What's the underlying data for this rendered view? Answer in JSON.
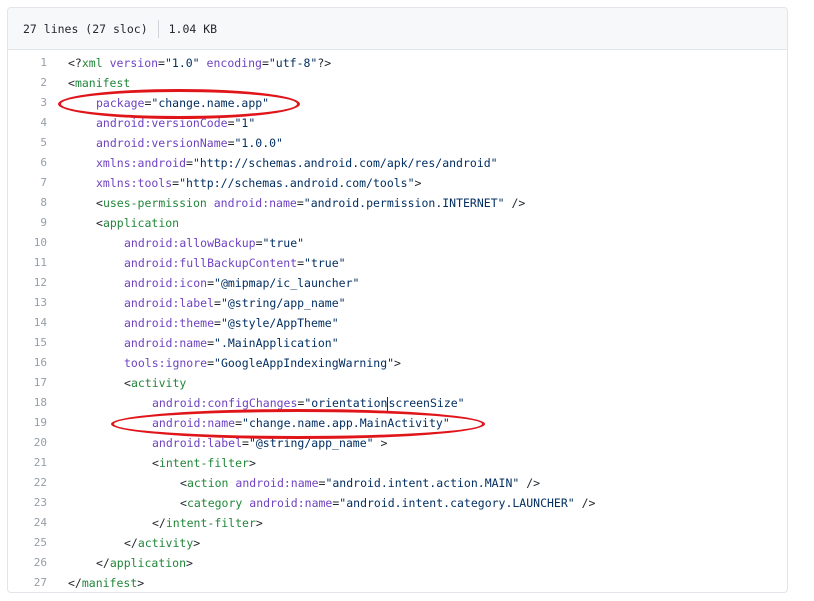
{
  "header": {
    "lines_info": "27 lines (27 sloc)",
    "size": "1.04 KB"
  },
  "code": {
    "lines": [
      {
        "n": "1",
        "indent": 0,
        "tokens": [
          {
            "t": "plain",
            "v": "<?"
          },
          {
            "t": "tag",
            "v": "xml"
          },
          {
            "t": "plain",
            "v": " "
          },
          {
            "t": "attr",
            "v": "version"
          },
          {
            "t": "plain",
            "v": "="
          },
          {
            "t": "str",
            "v": "\"1.0\""
          },
          {
            "t": "plain",
            "v": " "
          },
          {
            "t": "attr",
            "v": "encoding"
          },
          {
            "t": "plain",
            "v": "="
          },
          {
            "t": "str",
            "v": "\"utf-8\""
          },
          {
            "t": "plain",
            "v": "?>"
          }
        ]
      },
      {
        "n": "2",
        "indent": 0,
        "tokens": [
          {
            "t": "plain",
            "v": "<"
          },
          {
            "t": "tag",
            "v": "manifest"
          }
        ]
      },
      {
        "n": "3",
        "indent": 1,
        "tokens": [
          {
            "t": "attr",
            "v": "package"
          },
          {
            "t": "plain",
            "v": "="
          },
          {
            "t": "str",
            "v": "\"change.name.app\""
          }
        ]
      },
      {
        "n": "4",
        "indent": 1,
        "tokens": [
          {
            "t": "attr",
            "v": "android:versionCode"
          },
          {
            "t": "plain",
            "v": "="
          },
          {
            "t": "str",
            "v": "\"1\""
          }
        ]
      },
      {
        "n": "5",
        "indent": 1,
        "tokens": [
          {
            "t": "attr",
            "v": "android:versionName"
          },
          {
            "t": "plain",
            "v": "="
          },
          {
            "t": "str",
            "v": "\"1.0.0\""
          }
        ]
      },
      {
        "n": "6",
        "indent": 1,
        "tokens": [
          {
            "t": "attr",
            "v": "xmlns:android"
          },
          {
            "t": "plain",
            "v": "="
          },
          {
            "t": "str",
            "v": "\"http://schemas.android.com/apk/res/android\""
          }
        ]
      },
      {
        "n": "7",
        "indent": 1,
        "tokens": [
          {
            "t": "attr",
            "v": "xmlns:tools"
          },
          {
            "t": "plain",
            "v": "="
          },
          {
            "t": "str",
            "v": "\"http://schemas.android.com/tools\""
          },
          {
            "t": "plain",
            "v": ">"
          }
        ]
      },
      {
        "n": "8",
        "indent": 1,
        "tokens": [
          {
            "t": "plain",
            "v": "<"
          },
          {
            "t": "tag",
            "v": "uses-permission"
          },
          {
            "t": "plain",
            "v": " "
          },
          {
            "t": "attr",
            "v": "android:name"
          },
          {
            "t": "plain",
            "v": "="
          },
          {
            "t": "str",
            "v": "\"android.permission.INTERNET\""
          },
          {
            "t": "plain",
            "v": " />"
          }
        ]
      },
      {
        "n": "9",
        "indent": 1,
        "tokens": [
          {
            "t": "plain",
            "v": "<"
          },
          {
            "t": "tag",
            "v": "application"
          }
        ]
      },
      {
        "n": "10",
        "indent": 2,
        "tokens": [
          {
            "t": "attr",
            "v": "android:allowBackup"
          },
          {
            "t": "plain",
            "v": "="
          },
          {
            "t": "str",
            "v": "\"true\""
          }
        ]
      },
      {
        "n": "11",
        "indent": 2,
        "tokens": [
          {
            "t": "attr",
            "v": "android:fullBackupContent"
          },
          {
            "t": "plain",
            "v": "="
          },
          {
            "t": "str",
            "v": "\"true\""
          }
        ]
      },
      {
        "n": "12",
        "indent": 2,
        "tokens": [
          {
            "t": "attr",
            "v": "android:icon"
          },
          {
            "t": "plain",
            "v": "="
          },
          {
            "t": "str",
            "v": "\"@mipmap/ic_launcher\""
          }
        ]
      },
      {
        "n": "13",
        "indent": 2,
        "tokens": [
          {
            "t": "attr",
            "v": "android:label"
          },
          {
            "t": "plain",
            "v": "="
          },
          {
            "t": "str",
            "v": "\"@string/app_name\""
          }
        ]
      },
      {
        "n": "14",
        "indent": 2,
        "tokens": [
          {
            "t": "attr",
            "v": "android:theme"
          },
          {
            "t": "plain",
            "v": "="
          },
          {
            "t": "str",
            "v": "\"@style/AppTheme\""
          }
        ]
      },
      {
        "n": "15",
        "indent": 2,
        "tokens": [
          {
            "t": "attr",
            "v": "android:name"
          },
          {
            "t": "plain",
            "v": "="
          },
          {
            "t": "str",
            "v": "\".MainApplication\""
          }
        ]
      },
      {
        "n": "16",
        "indent": 2,
        "tokens": [
          {
            "t": "attr",
            "v": "tools:ignore"
          },
          {
            "t": "plain",
            "v": "="
          },
          {
            "t": "str",
            "v": "\"GoogleAppIndexingWarning\""
          },
          {
            "t": "plain",
            "v": ">"
          }
        ]
      },
      {
        "n": "17",
        "indent": 2,
        "tokens": [
          {
            "t": "plain",
            "v": "<"
          },
          {
            "t": "tag",
            "v": "activity"
          }
        ]
      },
      {
        "n": "18",
        "indent": 3,
        "tokens": [
          {
            "t": "attr",
            "v": "android:configChanges"
          },
          {
            "t": "plain",
            "v": "="
          },
          {
            "t": "str",
            "v": "\"orientation"
          },
          {
            "t": "caret",
            "v": ""
          },
          {
            "t": "str",
            "v": "screenSize\""
          }
        ]
      },
      {
        "n": "19",
        "indent": 3,
        "tokens": [
          {
            "t": "attr",
            "v": "android:name"
          },
          {
            "t": "plain",
            "v": "="
          },
          {
            "t": "str",
            "v": "\"change.name.app.MainActivity\""
          }
        ]
      },
      {
        "n": "20",
        "indent": 3,
        "tokens": [
          {
            "t": "attr",
            "v": "android:label"
          },
          {
            "t": "plain",
            "v": "="
          },
          {
            "t": "str",
            "v": "\"@string/app_name\""
          },
          {
            "t": "plain",
            "v": " >"
          }
        ]
      },
      {
        "n": "21",
        "indent": 3,
        "tokens": [
          {
            "t": "plain",
            "v": "<"
          },
          {
            "t": "tag",
            "v": "intent-filter"
          },
          {
            "t": "plain",
            "v": ">"
          }
        ]
      },
      {
        "n": "22",
        "indent": 4,
        "tokens": [
          {
            "t": "plain",
            "v": "<"
          },
          {
            "t": "tag",
            "v": "action"
          },
          {
            "t": "plain",
            "v": " "
          },
          {
            "t": "attr",
            "v": "android:name"
          },
          {
            "t": "plain",
            "v": "="
          },
          {
            "t": "str",
            "v": "\"android.intent.action.MAIN\""
          },
          {
            "t": "plain",
            "v": " />"
          }
        ]
      },
      {
        "n": "23",
        "indent": 4,
        "tokens": [
          {
            "t": "plain",
            "v": "<"
          },
          {
            "t": "tag",
            "v": "category"
          },
          {
            "t": "plain",
            "v": " "
          },
          {
            "t": "attr",
            "v": "android:name"
          },
          {
            "t": "plain",
            "v": "="
          },
          {
            "t": "str",
            "v": "\"android.intent.category.LAUNCHER\""
          },
          {
            "t": "plain",
            "v": " />"
          }
        ]
      },
      {
        "n": "24",
        "indent": 3,
        "tokens": [
          {
            "t": "plain",
            "v": "</"
          },
          {
            "t": "tag",
            "v": "intent-filter"
          },
          {
            "t": "plain",
            "v": ">"
          }
        ]
      },
      {
        "n": "25",
        "indent": 2,
        "tokens": [
          {
            "t": "plain",
            "v": "</"
          },
          {
            "t": "tag",
            "v": "activity"
          },
          {
            "t": "plain",
            "v": ">"
          }
        ]
      },
      {
        "n": "26",
        "indent": 1,
        "tokens": [
          {
            "t": "plain",
            "v": "</"
          },
          {
            "t": "tag",
            "v": "application"
          },
          {
            "t": "plain",
            "v": ">"
          }
        ]
      },
      {
        "n": "27",
        "indent": 0,
        "tokens": [
          {
            "t": "plain",
            "v": "</"
          },
          {
            "t": "tag",
            "v": "manifest"
          },
          {
            "t": "plain",
            "v": ">"
          }
        ]
      }
    ]
  },
  "annotations": {
    "color": "#e0151a"
  },
  "colors": {
    "tag": "#22863a",
    "attr": "#6f42c1",
    "string": "#032f62",
    "line_number": "#959da5"
  }
}
